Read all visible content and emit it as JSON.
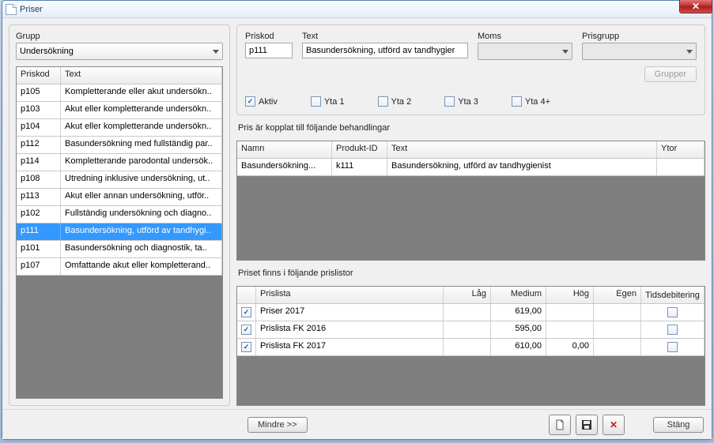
{
  "window": {
    "title": "Priser"
  },
  "left": {
    "group_label": "Grupp",
    "group_value": "Undersökning",
    "columns": {
      "code": "Priskod",
      "text": "Text"
    },
    "rows": [
      {
        "code": "p105",
        "text": "Kompletterande eller akut undersökn.."
      },
      {
        "code": "p103",
        "text": "Akut eller kompletterande undersökn.."
      },
      {
        "code": "p104",
        "text": "Akut eller kompletterande undersökn.."
      },
      {
        "code": "p112",
        "text": "Basundersökning med fullständig par.."
      },
      {
        "code": "p114",
        "text": "Kompletterande parodontal undersök.."
      },
      {
        "code": "p108",
        "text": "Utredning inklusive undersökning, ut.."
      },
      {
        "code": "p113",
        "text": "Akut eller annan undersökning, utför.."
      },
      {
        "code": "p102",
        "text": "Fullständig undersökning och diagno.."
      },
      {
        "code": "p111",
        "text": "Basundersökning, utförd av tandhygi..",
        "selected": true
      },
      {
        "code": "p101",
        "text": "Basundersökning och diagnostik, ta.."
      },
      {
        "code": "p107",
        "text": "Omfattande akut eller kompletterand.."
      }
    ]
  },
  "detail": {
    "labels": {
      "priskod": "Priskod",
      "text": "Text",
      "moms": "Moms",
      "prisgrupp": "Prisgrupp"
    },
    "priskod": "p111",
    "text": "Basundersökning, utförd av tandhygier",
    "moms": "",
    "prisgrupp": "",
    "grupper_btn": "Grupper",
    "aktiv_label": "Aktiv",
    "aktiv_checked": true,
    "yta1": "Yta 1",
    "yta2": "Yta 2",
    "yta3": "Yta 3",
    "yta4": "Yta 4+"
  },
  "linked": {
    "label": "Pris är kopplat till följande behandlingar",
    "columns": {
      "namn": "Namn",
      "pid": "Produkt-ID",
      "text": "Text",
      "ytor": "Ytor"
    },
    "rows": [
      {
        "namn": "Basundersökning...",
        "pid": "k111",
        "text": "Basundersökning, utförd av tandhygienist",
        "ytor": ""
      }
    ]
  },
  "pricelists": {
    "label": "Priset finns i följande prislistor",
    "columns": {
      "prislista": "Prislista",
      "lag": "Låg",
      "medium": "Medium",
      "hog": "Hög",
      "egen": "Egen",
      "tids": "Tidsdebitering"
    },
    "rows": [
      {
        "on": true,
        "name": "Priser 2017",
        "lag": "",
        "medium": "619,00",
        "hog": "",
        "egen": "",
        "tids": false
      },
      {
        "on": true,
        "name": "Prislista FK 2016",
        "lag": "",
        "medium": "595,00",
        "hog": "",
        "egen": "",
        "tids": false
      },
      {
        "on": true,
        "name": "Prislista FK 2017",
        "lag": "",
        "medium": "610,00",
        "hog": "0,00",
        "egen": "",
        "tids": false
      }
    ]
  },
  "footer": {
    "mindre": "Mindre >>",
    "stang": "Stäng"
  }
}
